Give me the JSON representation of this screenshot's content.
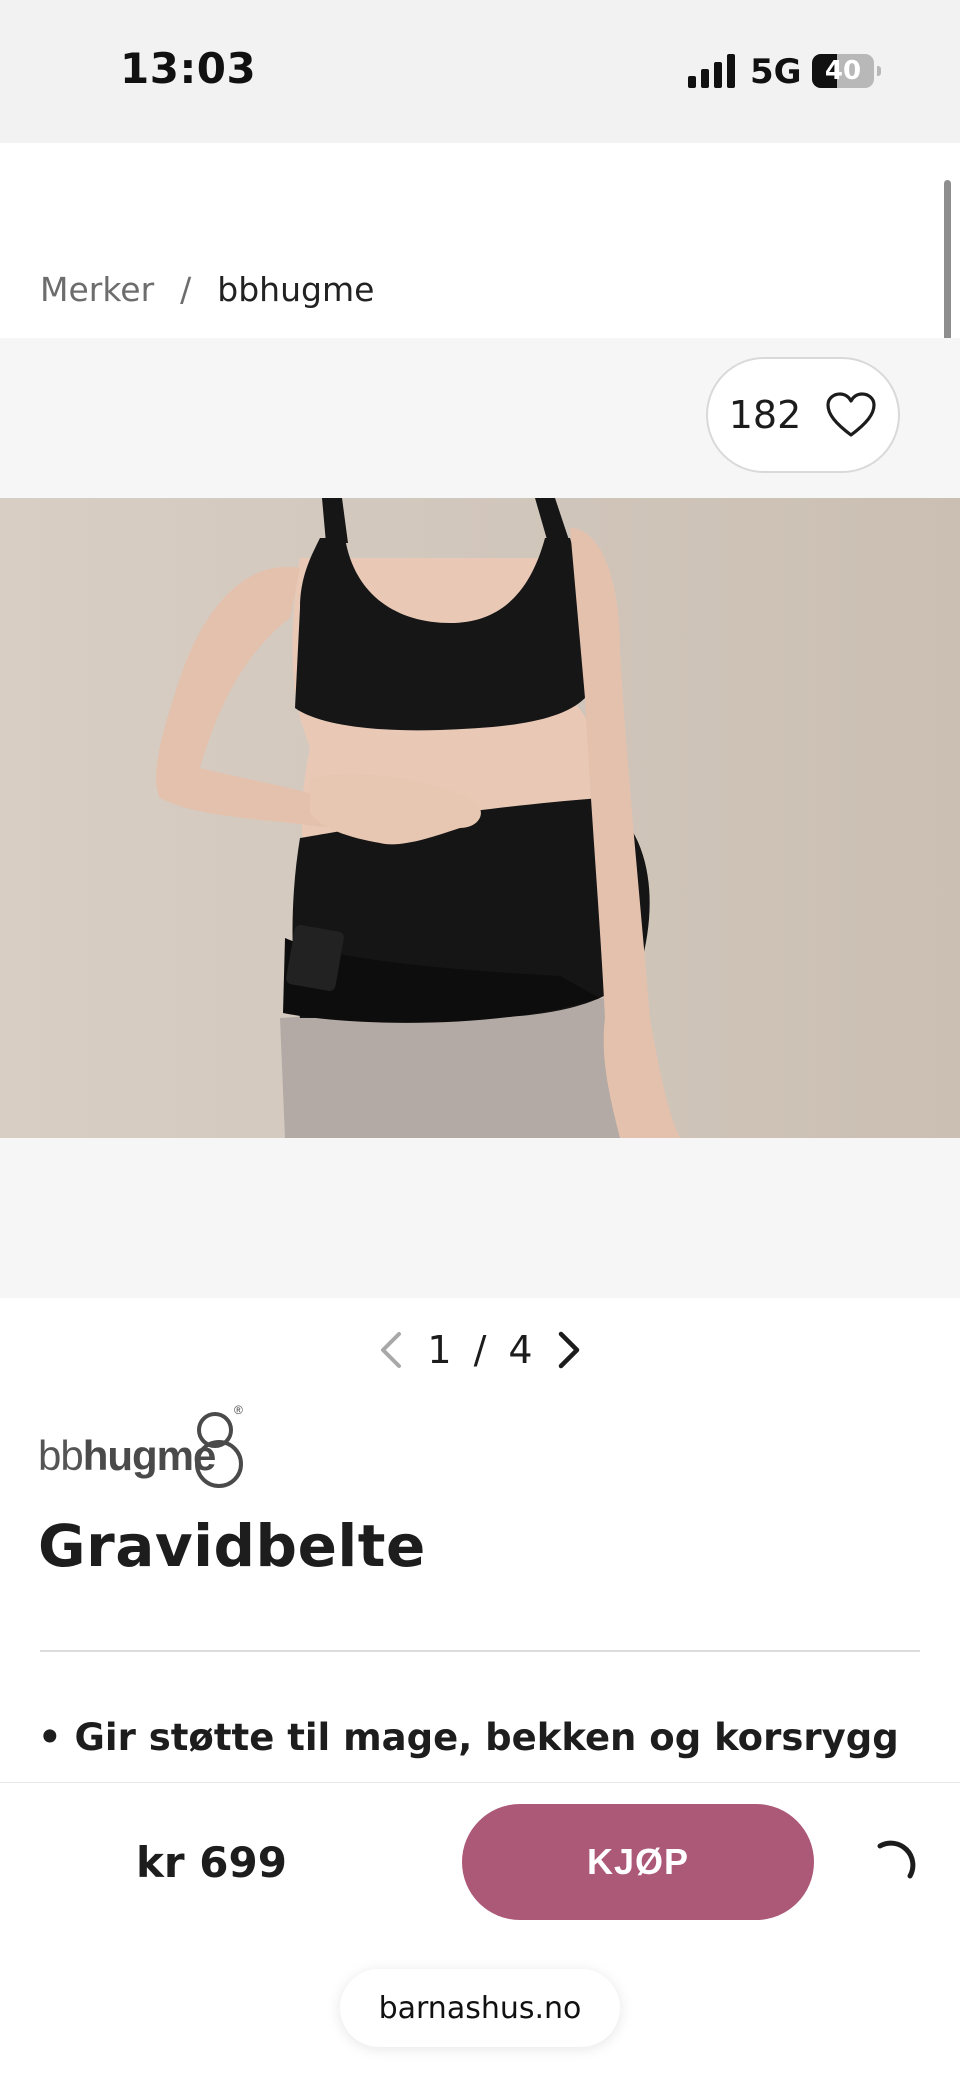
{
  "status_bar": {
    "time": "13:03",
    "network": "5G",
    "battery_level": "40",
    "battery_fraction": 0.4
  },
  "breadcrumb": {
    "parent": "Merker",
    "separator": "/",
    "current": "bbhugme"
  },
  "favorites": {
    "count": "182",
    "icon": "heart-icon"
  },
  "gallery": {
    "current": "1",
    "separator": "/",
    "total": "4"
  },
  "product": {
    "brand_logo_text": "bbhugme",
    "title": "Gravidbelte",
    "bullets": [
      "• Gir støtte til mage, bekken og korsrygg"
    ]
  },
  "purchase": {
    "price": "kr 699",
    "buy_label": "KJØP",
    "button_color": "#ac5877"
  },
  "browser": {
    "url": "barnashus.no"
  }
}
